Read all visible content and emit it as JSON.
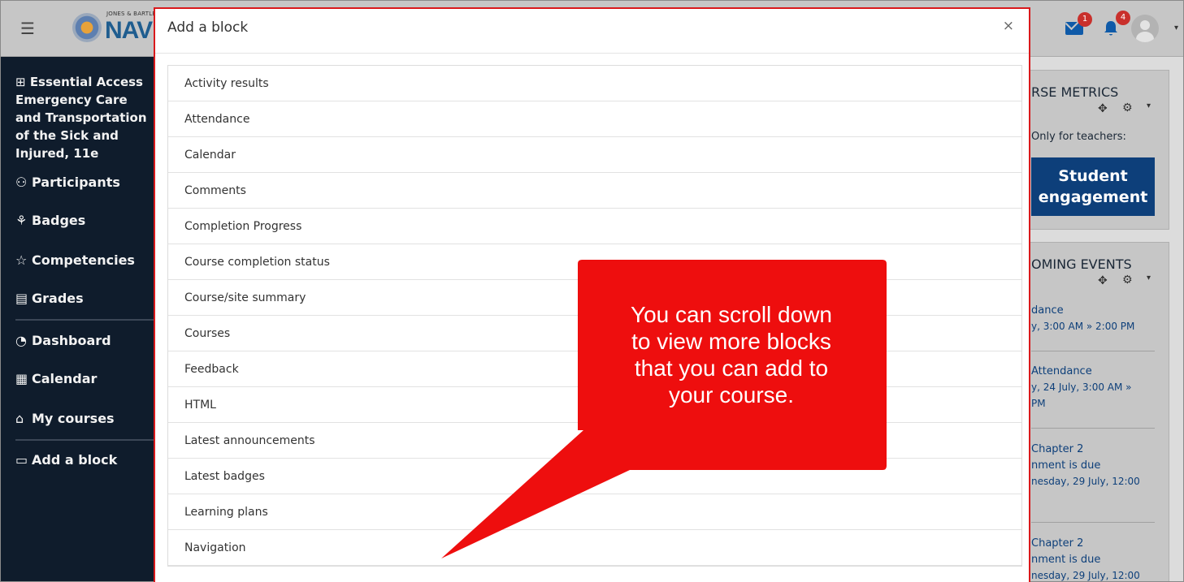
{
  "navbar": {
    "logo_small": "JONES & BARTLETT",
    "logo_big": "NAVI",
    "messages_count": "1",
    "notifications_count": "4",
    "icons": [
      "hamburger-icon",
      "logo-icon",
      "mail-icon",
      "bell-icon",
      "avatar-icon",
      "caret-down-icon"
    ]
  },
  "drawer": {
    "course_title": "Essential Access Emergency Care and Transportation of the Sick and Injured, 11e",
    "items": [
      {
        "label": "Participants",
        "icon": "participants-icon"
      },
      {
        "label": "Badges",
        "icon": "badge-icon"
      },
      {
        "label": "Competencies",
        "icon": "star-icon"
      },
      {
        "label": "Grades",
        "icon": "grades-icon"
      },
      {
        "label": "Dashboard",
        "icon": "dashboard-icon"
      },
      {
        "label": "Calendar",
        "icon": "calendar-icon"
      },
      {
        "label": "My courses",
        "icon": "mortarboard-icon"
      },
      {
        "label": "Add a block",
        "icon": "folder-icon"
      }
    ]
  },
  "right": {
    "metrics_title": "RSE METRICS",
    "metrics_note": "Only for teachers:",
    "engage_line1": "Student",
    "engage_line2": "engagement",
    "events_title": "OMING EVENTS",
    "events": [
      {
        "l1": "dance",
        "l2": "y, 3:00 AM » 2:00 PM",
        "l3": ""
      },
      {
        "l1": "Attendance",
        "l2": "y, 24 July, 3:00 AM »",
        "l3": "PM"
      },
      {
        "l1": "Chapter 2",
        "l2": "nment is due",
        "l3": "nesday, 29 July, 12:00"
      },
      {
        "l1": "Chapter 2",
        "l2": "nment is due",
        "l3": "nesday, 29 July, 12:00"
      }
    ]
  },
  "modal": {
    "title": "Add a block",
    "close_symbol": "×",
    "blocks": [
      "Activity results",
      "Attendance",
      "Calendar",
      "Comments",
      "Completion Progress",
      "Course completion status",
      "Course/site summary",
      "Courses",
      "Feedback",
      "HTML",
      "Latest announcements",
      "Latest badges",
      "Learning plans",
      "Navigation"
    ]
  },
  "callout": {
    "line1": "You can scroll down",
    "line2": "to view more blocks",
    "line3": "that you can add to",
    "line4": "your course.",
    "color": "#ee0e0e"
  },
  "colors": {
    "drawer_bg": "#0f1c2c",
    "accent": "#0d3f7a",
    "modal_border": "#d9191c"
  }
}
